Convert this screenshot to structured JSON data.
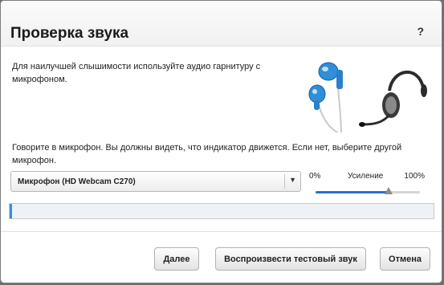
{
  "dialog": {
    "title": "Проверка звука",
    "help_label": "?",
    "intro_text": "Для наилучшей слышимости используйте аудио гарнитуру с микрофоном.",
    "instruction_text": "Говорите в микрофон. Вы должны видеть, что индикатор движется. Если нет, выберите другой микрофон."
  },
  "microphone": {
    "selected": "Микрофон (HD Webcam C270)",
    "arrow_icon": "▼"
  },
  "gain": {
    "min_label": "0%",
    "mid_label": "Усиление",
    "max_label": "100%",
    "level": 0.7
  },
  "meter": {
    "level": 0.005
  },
  "buttons": {
    "next": "Далее",
    "play_test_sound": "Воспроизвести тестовый звук",
    "cancel": "Отмена"
  },
  "colors": {
    "accent": "#2a6fd6",
    "earbud": "#2f8fd8"
  }
}
